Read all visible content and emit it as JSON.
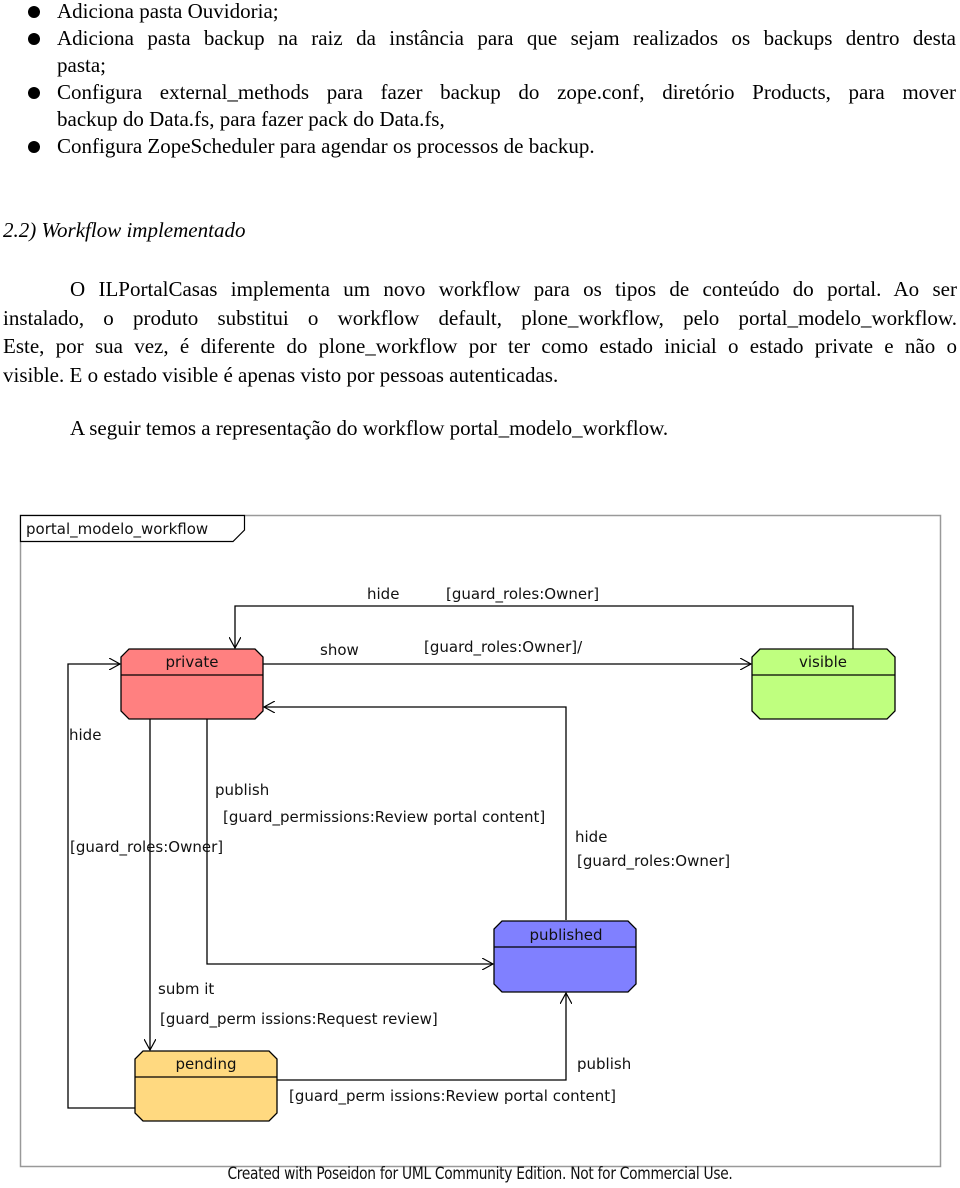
{
  "bullets": [
    {
      "lines": [
        "Adiciona pasta Ouvidoria;"
      ]
    },
    {
      "lines": [
        "Adiciona pasta backup na raiz da instância para que sejam realizados os backups dentro desta",
        "pasta;"
      ]
    },
    {
      "lines": [
        "Configura external_methods para fazer backup do zope.conf, diretório Products, para mover",
        "backup do Data.fs, para fazer pack do Data.fs,"
      ]
    },
    {
      "lines": [
        "Configura ZopeScheduler para agendar os processos de backup."
      ]
    }
  ],
  "section": {
    "heading": "2.2) Workflow implementado",
    "paragraph_lines": [
      "O ILPortalCasas implementa um novo workflow para os tipos de conteúdo do portal. Ao ser",
      "instalado, o produto substitui o workflow default, plone_workflow, pelo portal_modelo_workflow.",
      "Este, por sua vez, é diferente do plone_workflow por ter como estado inicial o estado private e não o",
      "visible. E o estado visible é apenas visto por pessoas autenticadas."
    ],
    "intro": "A seguir temos a representação do workflow portal_modelo_workflow."
  },
  "diagram": {
    "title": "portal_modelo_workflow",
    "colors": {
      "private": "#ff8080",
      "visible": "#bfff7f",
      "published": "#8080ff",
      "pending": "#ffd980",
      "frame": "#999999",
      "line": "#000000"
    },
    "states": {
      "private": "private",
      "visible": "visible",
      "published": "published",
      "pending": "pending"
    },
    "transitions": {
      "visible_to_private_hide": {
        "name": "hide",
        "guard": "[guard_roles:Owner]"
      },
      "private_to_visible_show": {
        "name": "show",
        "guard": "[guard_roles:Owner]/"
      },
      "pending_to_private_hide": {
        "name": "hide",
        "guard": "[guard_roles:Owner]"
      },
      "private_to_published_publish": {
        "name": "publish",
        "guard": "[guard_permissions:Review portal content]"
      },
      "published_to_private_hide": {
        "name": "hide",
        "guard": "[guard_roles:Owner]"
      },
      "private_to_pending_submit": {
        "name": "subm it",
        "guard": "[guard_perm issions:Request review]"
      },
      "pending_to_published_publish": {
        "name": "publish",
        "guard": "[guard_perm issions:Review portal content]"
      }
    },
    "footer": "Created with Poseidon for UML Community Edition. Not for Commercial Use."
  }
}
